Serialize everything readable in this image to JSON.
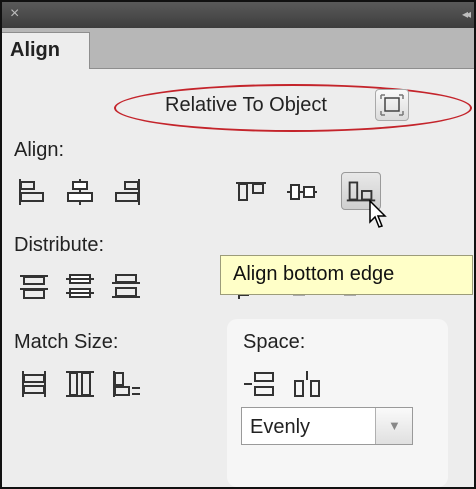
{
  "titlebar": {
    "close_glyph": "×",
    "collapse_glyph": "◂◂"
  },
  "tab": {
    "label": "Align"
  },
  "relative": {
    "label": "Relative To Object",
    "icon": "relative-to-object-icon"
  },
  "sections": {
    "align": "Align:",
    "distribute": "Distribute:",
    "match_size": "Match Size:",
    "space": "Space:"
  },
  "space_select": {
    "value": "Evenly",
    "arrow": "▼"
  },
  "tooltip": {
    "text": "Align bottom edge"
  },
  "colors": {
    "annotation_ellipse": "#c4242b",
    "tooltip_bg": "#ffffc8",
    "panel_bg": "#ededed"
  }
}
